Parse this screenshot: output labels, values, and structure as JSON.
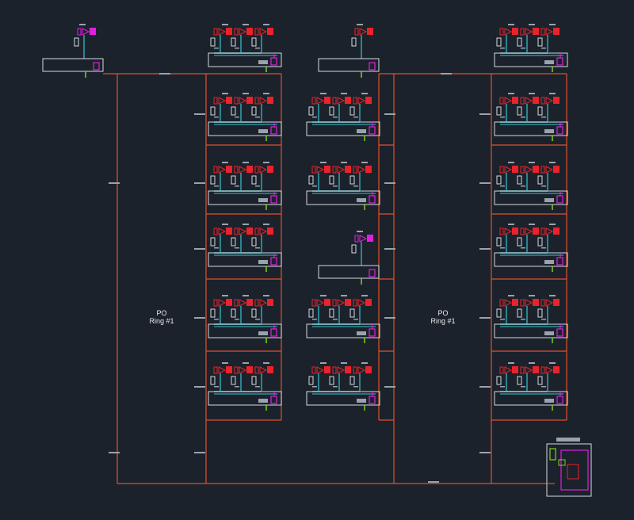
{
  "rings": [
    {
      "title": "PO",
      "subtitle": "Ring #1"
    },
    {
      "title": "PO",
      "subtitle": "Ring #1"
    }
  ],
  "colors": {
    "background": "#1b222b",
    "ring_line": "#e2502c",
    "wire_cyan": "#35c6d4",
    "wire_magenta": "#e020e0",
    "wire_green": "#7ed321",
    "equipment_red": "#e8232b",
    "frame_white": "#d6dbe0",
    "label_gray": "#9aa3ad"
  }
}
